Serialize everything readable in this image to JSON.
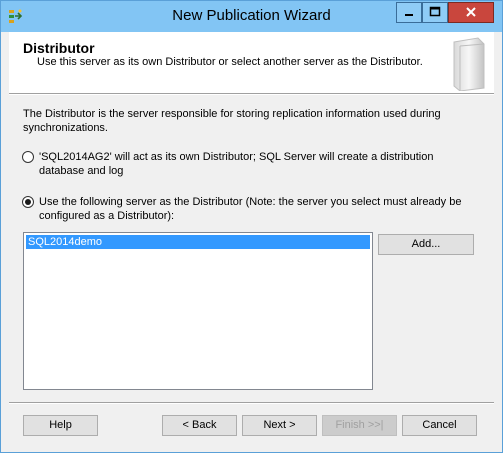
{
  "window": {
    "title": "New Publication Wizard",
    "icon": "wizard-icon"
  },
  "header": {
    "title": "Distributor",
    "subtitle": "Use this server as its own Distributor or select another server as the Distributor."
  },
  "description": "The Distributor is the server responsible for storing replication information used during synchronizations.",
  "options": [
    {
      "label": "'SQL2014AG2' will act as its own Distributor; SQL Server will create a distribution database and log",
      "selected": false
    },
    {
      "label": "Use the following server as the Distributor (Note: the server you select must already be configured as a Distributor):",
      "selected": true
    }
  ],
  "server_list": {
    "items": [
      "SQL2014demo"
    ],
    "selected_index": 0
  },
  "add_button": "Add...",
  "footer": {
    "help": "Help",
    "back": "< Back",
    "next": "Next >",
    "finish": "Finish >>|",
    "cancel": "Cancel"
  },
  "colors": {
    "titlebar": "#82c5f4",
    "close": "#c9463d",
    "selection": "#3399ff"
  }
}
